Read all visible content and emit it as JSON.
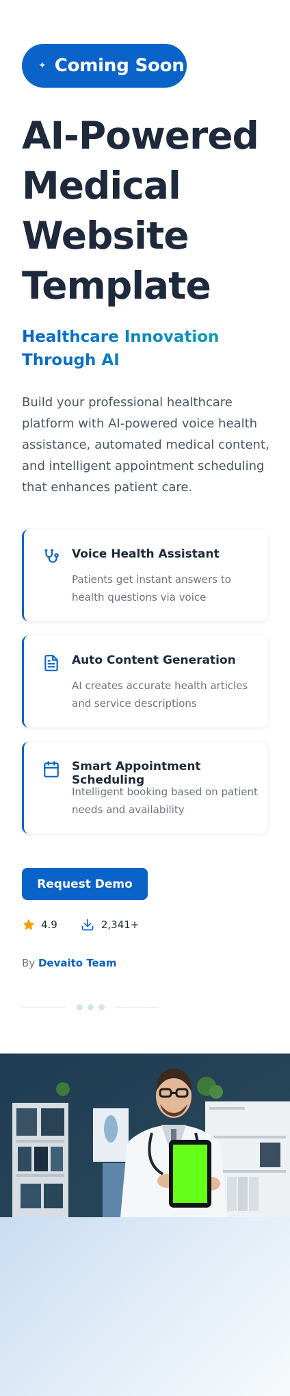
{
  "hero": {
    "badge_icon": "sparkle-icon",
    "badge_label": "Coming Soon",
    "title_lines": [
      "AI-Powered",
      "Medical",
      "Website",
      "Template"
    ],
    "subtitle_lines": [
      "Healthcare Innovation",
      "Through AI"
    ],
    "description": "Build your professional healthcare platform with AI-powered voice health assistance, automated medical content, and intelligent appointment scheduling that enhances patient care."
  },
  "features": [
    {
      "icon": "stethoscope-icon",
      "title": "Voice Health Assistant",
      "description": "Patients get instant answers to health questions via voice"
    },
    {
      "icon": "document-icon",
      "title": "Auto Content Generation",
      "description": "AI creates accurate health articles and service descriptions"
    },
    {
      "icon": "calendar-icon",
      "title": "Smart Appointment Scheduling",
      "description": "Intelligent booking based on patient needs and availability"
    }
  ],
  "cta": {
    "demo_label": "Request Demo"
  },
  "stats": {
    "rating": "4.9",
    "downloads": "2,341+"
  },
  "byline": {
    "prefix": "By",
    "team": "Devaito Team"
  },
  "colors": {
    "primary": "#0a63c9",
    "accent_teal": "#0aa0b9",
    "star": "#f59e0b",
    "screen_green": "#66ff1a"
  }
}
